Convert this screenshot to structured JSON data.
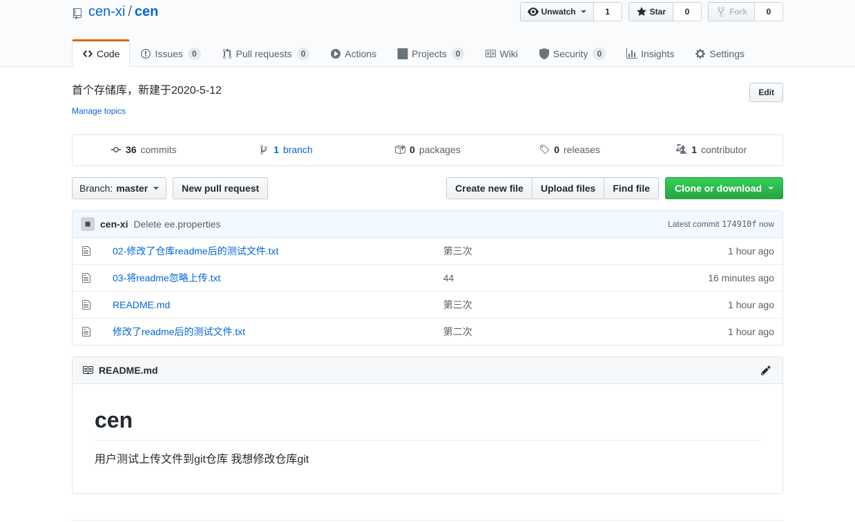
{
  "repo": {
    "owner": "cen-xi",
    "separator": "/",
    "name": "cen",
    "icon": "repo-icon"
  },
  "pagehead_actions": {
    "watch": {
      "label": "Unwatch",
      "count": "1",
      "icon": "eye-icon"
    },
    "star": {
      "label": "Star",
      "count": "0",
      "icon": "star-icon"
    },
    "fork": {
      "label": "Fork",
      "count": "0",
      "icon": "fork-icon",
      "disabled": true
    }
  },
  "nav": {
    "items": [
      {
        "label": "Code",
        "icon": "code-icon",
        "count": null,
        "selected": true
      },
      {
        "label": "Issues",
        "icon": "issue-opened-icon",
        "count": "0",
        "selected": false
      },
      {
        "label": "Pull requests",
        "icon": "git-pull-request-icon",
        "count": "0",
        "selected": false
      },
      {
        "label": "Actions",
        "icon": "play-icon",
        "count": null,
        "selected": false
      },
      {
        "label": "Projects",
        "icon": "project-icon",
        "count": "0",
        "selected": false
      },
      {
        "label": "Wiki",
        "icon": "book-icon",
        "count": null,
        "selected": false
      },
      {
        "label": "Security",
        "icon": "shield-icon",
        "count": "0",
        "selected": false
      },
      {
        "label": "Insights",
        "icon": "graph-icon",
        "count": null,
        "selected": false
      },
      {
        "label": "Settings",
        "icon": "gear-icon",
        "count": null,
        "selected": false
      }
    ]
  },
  "description": {
    "text": "首个存储库，新建于2020-5-12",
    "manage_topics": "Manage topics",
    "edit_button": "Edit"
  },
  "summary": {
    "commits": {
      "count": "36",
      "label": "commits",
      "icon": "history-icon"
    },
    "branches": {
      "count": "1",
      "label": "branch",
      "icon": "git-branch-icon"
    },
    "packages": {
      "count": "0",
      "label": "packages",
      "icon": "package-icon"
    },
    "releases": {
      "count": "0",
      "label": "releases",
      "icon": "tag-icon"
    },
    "contributors": {
      "count": "1",
      "label": "contributor",
      "icon": "people-icon"
    }
  },
  "toolbar": {
    "branch_label": "Branch:",
    "branch_value": "master",
    "new_pull_request": "New pull request",
    "create_new_file": "Create new file",
    "upload_files": "Upload files",
    "find_file": "Find file",
    "clone_or_download": "Clone or download",
    "clone_button_color": "#28a745"
  },
  "latest_commit": {
    "author": "cen-xi",
    "message": "Delete ee.properties",
    "prefix": "Latest commit",
    "sha": "174910f",
    "time": "now"
  },
  "files": {
    "columns": [
      "name",
      "message",
      "age"
    ],
    "rows": [
      {
        "icon": "file-icon",
        "name": "02-修改了仓库readme后的测试文件.txt",
        "message": "第三次",
        "age": "1 hour ago"
      },
      {
        "icon": "file-icon",
        "name": "03-将readme忽略上传.txt",
        "message": "44",
        "age": "16 minutes ago"
      },
      {
        "icon": "file-icon",
        "name": "README.md",
        "message": "第三次",
        "age": "1 hour ago"
      },
      {
        "icon": "file-icon",
        "name": "修改了readme后的测试文件.txt",
        "message": "第二次",
        "age": "1 hour ago"
      }
    ]
  },
  "readme": {
    "title": "README.md",
    "title_icon": "book-icon",
    "edit_icon": "pencil-icon",
    "heading": "cen",
    "body": "用户测试上传文件到git仓库 我想修改仓库git"
  }
}
